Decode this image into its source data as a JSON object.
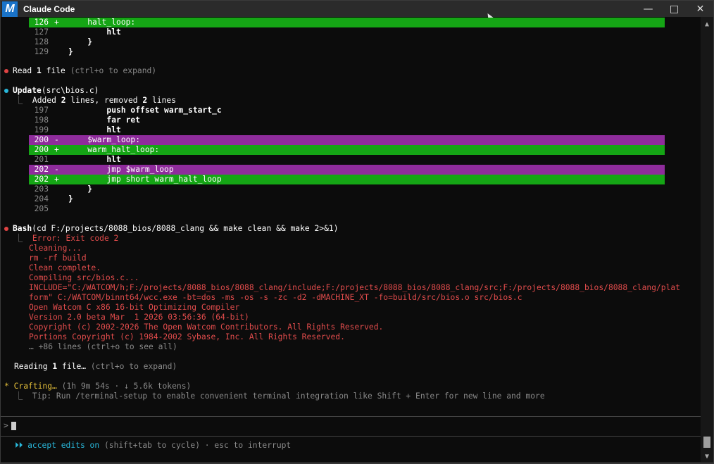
{
  "window": {
    "title": "Claude Code",
    "icon_letter": "M",
    "controls": [
      "minimize-icon",
      "maximize-icon",
      "close-icon"
    ]
  },
  "diff_top": [
    {
      "n": "126",
      "sign": "+",
      "code": "    halt_loop:",
      "type": "add"
    },
    {
      "n": "127",
      "sign": "",
      "code": "        hlt",
      "type": "ctx"
    },
    {
      "n": "128",
      "sign": "",
      "code": "    }",
      "type": "ctx"
    },
    {
      "n": "129",
      "sign": "",
      "code": "}",
      "type": "ctx"
    }
  ],
  "read_action": {
    "verb": "Read",
    "count": "1",
    "noun": "file",
    "hint": "(ctrl+o to expand)"
  },
  "update_action": {
    "verb": "Update",
    "target": "(src\\bios.c)",
    "summary_pre": "Added ",
    "added": "2",
    "summary_mid": " lines, removed ",
    "removed": "2",
    "summary_post": " lines"
  },
  "diff_update": [
    {
      "n": "197",
      "sign": "",
      "code": "        push offset warm_start_c",
      "type": "ctx"
    },
    {
      "n": "198",
      "sign": "",
      "code": "        far ret",
      "type": "ctx"
    },
    {
      "n": "199",
      "sign": "",
      "code": "        hlt",
      "type": "ctx"
    },
    {
      "n": "200",
      "sign": "-",
      "code": "    $warm_loop:",
      "type": "del"
    },
    {
      "n": "200",
      "sign": "+",
      "code": "    warm_halt_loop:",
      "type": "add"
    },
    {
      "n": "201",
      "sign": "",
      "code": "        hlt",
      "type": "ctx"
    },
    {
      "n": "202",
      "sign": "-",
      "code": "        jmp $warm_loop",
      "type": "del"
    },
    {
      "n": "202",
      "sign": "+",
      "code": "        jmp short warm_halt_loop",
      "type": "add"
    },
    {
      "n": "203",
      "sign": "",
      "code": "    }",
      "type": "ctx"
    },
    {
      "n": "204",
      "sign": "",
      "code": "}",
      "type": "ctx"
    },
    {
      "n": "205",
      "sign": "",
      "code": "",
      "type": "ctx"
    }
  ],
  "bash_action": {
    "verb": "Bash",
    "command": "(cd F:/projects/8088_bios/8088_clang && make clean && make 2>&1)"
  },
  "bash_output": [
    "Error: Exit code 2",
    "Cleaning...",
    "rm -rf build",
    "Clean complete.",
    "Compiling src/bios.c...",
    "INCLUDE=\"C:/WATCOM/h;F:/projects/8088_bios/8088_clang/include;F:/projects/8088_bios/8088_clang/src;F:/projects/8088_bios/8088_clang/plat",
    "form\" C:/WATCOM/binnt64/wcc.exe -bt=dos -ms -os -s -zc -d2 -dMACHINE_XT -fo=build/src/bios.o src/bios.c",
    "Open Watcom C x86 16-bit Optimizing Compiler",
    "Version 2.0 beta Mar  1 2026 03:56:36 (64-bit)",
    "Copyright (c) 2002-2026 The Open Watcom Contributors. All Rights Reserved.",
    "Portions Copyright (c) 1984-2002 Sybase, Inc. All Rights Reserved."
  ],
  "bash_more": "… +86 lines (ctrl+o to see all)",
  "reading": {
    "pre": "Reading ",
    "count": "1",
    "post": " file…",
    "hint": "(ctrl+o to expand)"
  },
  "status": {
    "star": "*",
    "label": "Crafting…",
    "meta": "(1h 9m 54s · ↓ 5.6k tokens)",
    "tip": "Tip: Run /terminal-setup to enable convenient terminal integration like Shift + Enter for new line and more"
  },
  "prompt": {
    "symbol": ">",
    "value": ""
  },
  "footer": {
    "arrows": "⏵⏵",
    "mode": "accept edits on",
    "hint": "(shift+tab to cycle) · esc to interrupt"
  }
}
